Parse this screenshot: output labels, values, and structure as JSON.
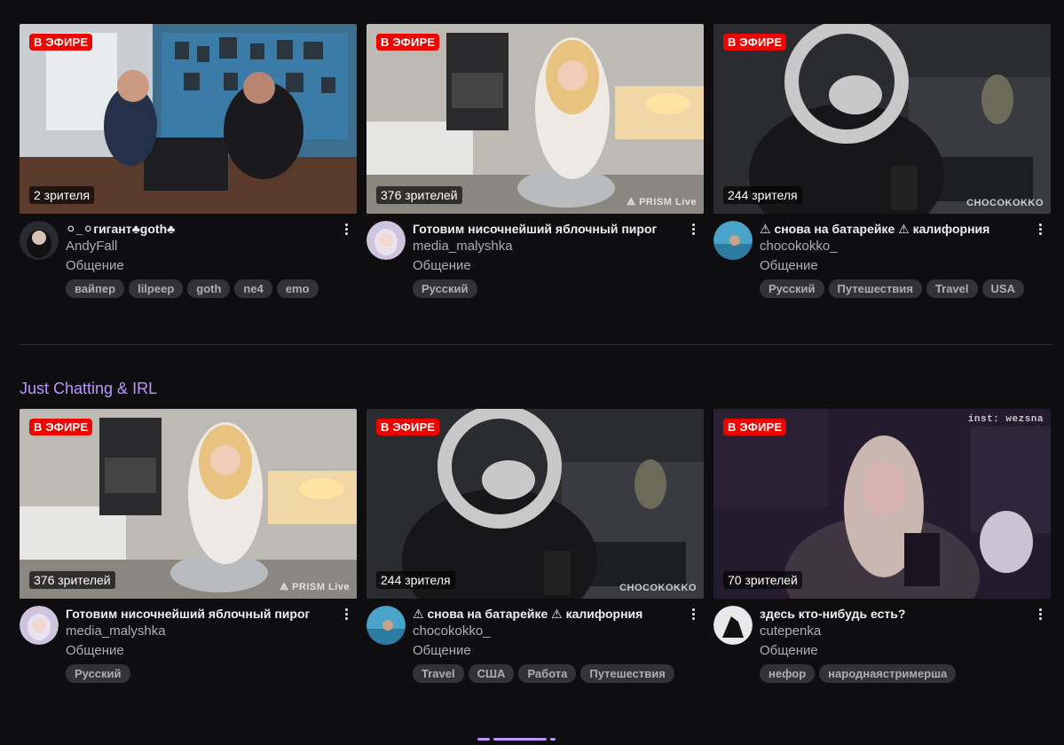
{
  "labels": {
    "live": "В ЭФИРЕ"
  },
  "row1": [
    {
      "viewers": "2 зрителя",
      "title": "⚪_⚪гигант♣goth♣",
      "channel": "AndyFall",
      "category": "Общение",
      "tags": [
        "вайпер",
        "lilpeep",
        "goth",
        "ne4",
        "emo"
      ],
      "watermark": ""
    },
    {
      "viewers": "376 зрителей",
      "title": "Готовим нисочнейший яблочный пирог",
      "channel": "media_malyshka",
      "category": "Общение",
      "tags": [
        "Русский"
      ],
      "watermark": "⟁ PRISM Live"
    },
    {
      "viewers": "244 зрителя",
      "title": "⚠ снова на батарейке ⚠ калифорния",
      "channel": "chocokokko_",
      "category": "Общение",
      "tags": [
        "Русский",
        "Путешествия",
        "Travel",
        "USA"
      ],
      "watermark": "CHOCOKOKKO"
    }
  ],
  "section": {
    "title": "Just Chatting & IRL"
  },
  "row2": [
    {
      "viewers": "376 зрителей",
      "title": "Готовим нисочнейший яблочный пирог",
      "channel": "media_malyshka",
      "category": "Общение",
      "tags": [
        "Русский"
      ],
      "watermark": "⟁ PRISM Live"
    },
    {
      "viewers": "244 зрителя",
      "title": "⚠ снова на батарейке ⚠ калифорния",
      "channel": "chocokokko_",
      "category": "Общение",
      "tags": [
        "Travel",
        "США",
        "Работа",
        "Путешествия"
      ],
      "watermark": "CHOCOKOKKO"
    },
    {
      "viewers": "70 зрителей",
      "title": "здесь кто-нибудь есть?",
      "channel": "cutepenka",
      "category": "Общение",
      "tags": [
        "нефор",
        "народнаястримерша"
      ],
      "watermark": "inst: wezsna"
    }
  ]
}
